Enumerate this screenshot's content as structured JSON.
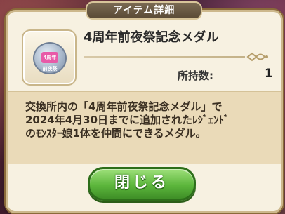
{
  "dialog": {
    "title": "アイテム詳細",
    "item": {
      "name": "4周年前夜祭記念メダル",
      "icon": "medal-icon",
      "icon_text": "4周年\n前夜祭"
    },
    "owned_label": "所持数:",
    "owned_count": "1",
    "description": "交換所内の「4周年前夜祭記念メダル」で\n2024年4月30日までに追加されたﾚｼﾞｪﾝﾄﾞ\nのﾓﾝｽﾀｰ娘1体を仲間にできるメダル。",
    "close_label": "閉じる"
  },
  "colors": {
    "panel": "#f7f1e1",
    "desc_band": "#eadab8",
    "button_green": "#5cb63c"
  }
}
